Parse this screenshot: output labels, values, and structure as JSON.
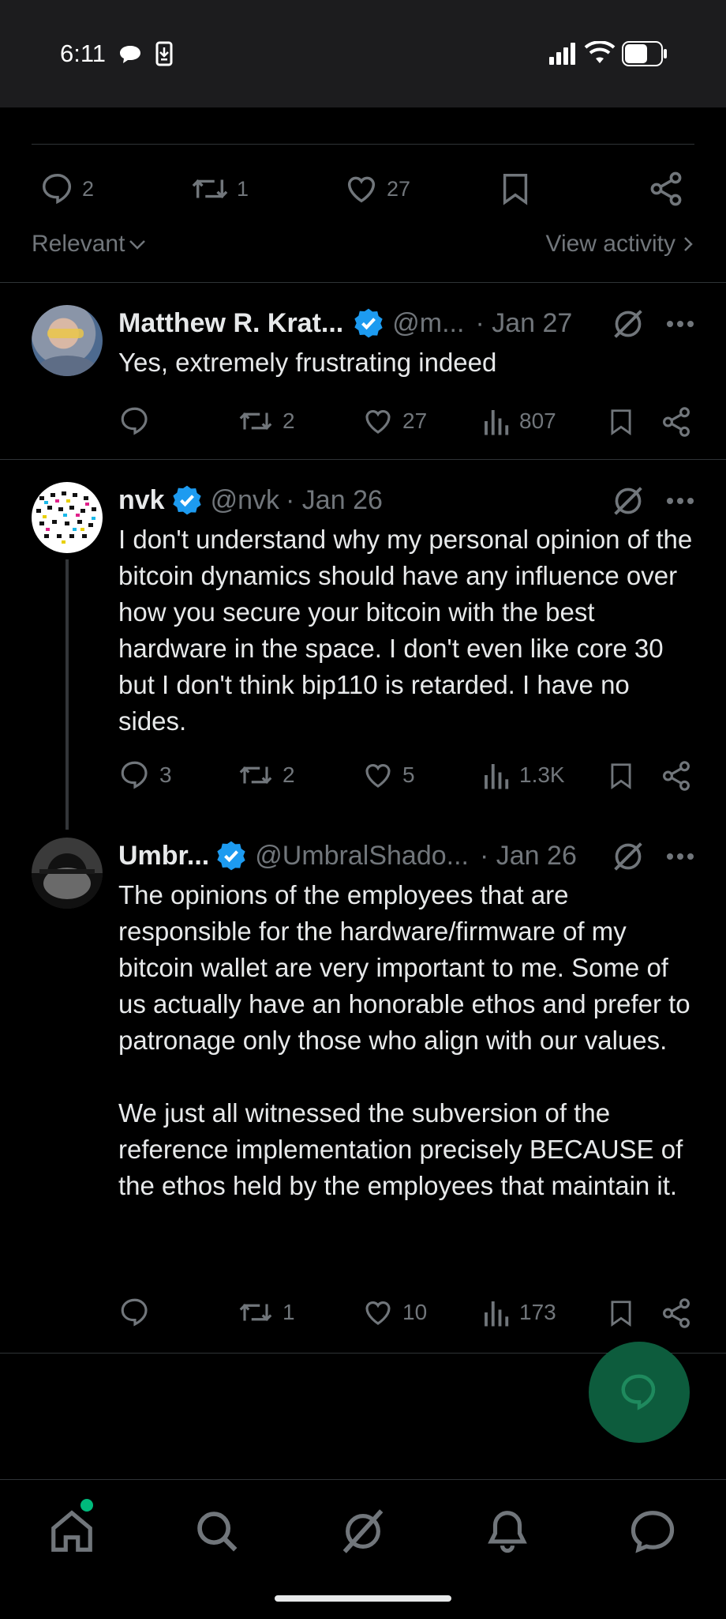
{
  "status": {
    "time": "6:11"
  },
  "top_post_actions": {
    "replies": "2",
    "reposts": "1",
    "likes": "27"
  },
  "sort": {
    "label": "Relevant",
    "view_activity": "View activity"
  },
  "replies": [
    {
      "name": "Matthew R. Krat...",
      "handle": "@m...",
      "date": "· Jan 27",
      "text": [
        "Yes, extremely frustrating indeed"
      ],
      "replies": "",
      "reposts": "2",
      "likes": "27",
      "views": "807"
    },
    {
      "name": "nvk",
      "handle": "@nvk",
      "date": "· Jan 26",
      "text": [
        "I don't understand why my personal opinion of the bitcoin dynamics should have any influence over how you secure your bitcoin with the best hardware in the space. I don't even like core 30 but I don't think bip110 is retarded. I have no sides."
      ],
      "replies": "3",
      "reposts": "2",
      "likes": "5",
      "views": "1.3K"
    },
    {
      "name": "Umbr...",
      "handle": "@UmbralShado...",
      "date": "· Jan 26",
      "text": [
        "The opinions of the employees that are responsible for the hardware/firmware of my bitcoin wallet are very important to me. Some of us actually have an honorable ethos and prefer to patronage only those who align with our values.",
        "We just all witnessed the subversion of the reference implementation precisely BECAUSE of the ethos held by the employees that maintain it."
      ],
      "replies": "",
      "reposts": "1",
      "likes": "10",
      "views": "173"
    }
  ],
  "colors": {
    "accent": "#1d9bf0",
    "muted": "#71767b",
    "fab": "#0d5c3d",
    "notification_dot": "#00ba7c"
  },
  "icons": [
    "reply-icon",
    "repost-icon",
    "like-icon",
    "views-icon",
    "bookmark-icon",
    "share-icon",
    "grok-icon",
    "more-icon",
    "verified-badge-icon",
    "home-icon",
    "search-icon",
    "grok-icon",
    "notifications-icon",
    "messages-icon"
  ]
}
